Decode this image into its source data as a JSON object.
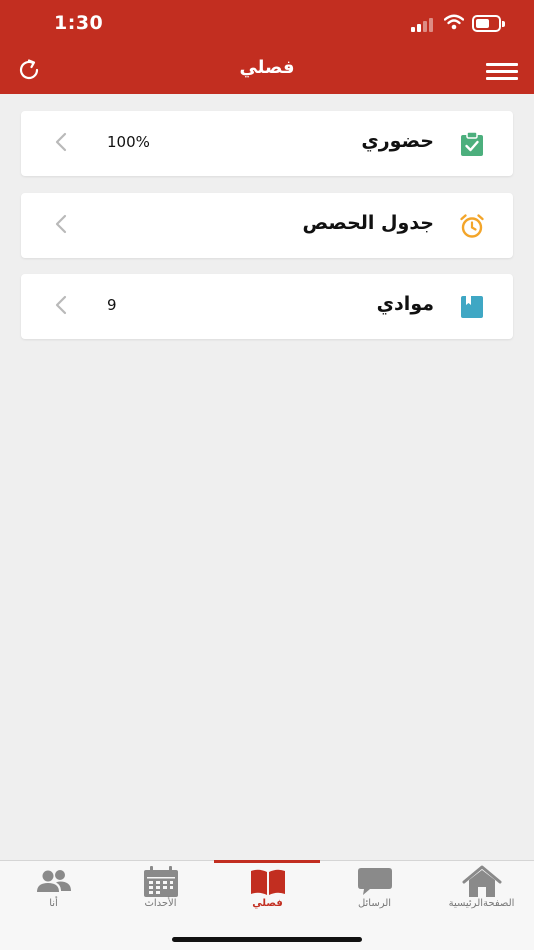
{
  "status": {
    "time": "1:30"
  },
  "header": {
    "title": "فصلي",
    "refresh_icon": "refresh-icon",
    "menu_icon": "hamburger-menu-icon"
  },
  "colors": {
    "brand": "#c22e20",
    "attendance": "#4caf7d",
    "schedule": "#f3a52a",
    "subjects": "#3fa7c4"
  },
  "cards": [
    {
      "label": "حضوري",
      "value": "100%",
      "icon": "clipboard-check-icon"
    },
    {
      "label": "جدول الحصص",
      "value": "",
      "icon": "alarm-clock-icon"
    },
    {
      "label": "موادي",
      "value": "9",
      "icon": "book-icon"
    }
  ],
  "tabs": [
    {
      "label": "أنا",
      "icon": "people-icon",
      "active": false
    },
    {
      "label": "الأحداث",
      "icon": "calendar-icon",
      "active": false
    },
    {
      "label": "فصلي",
      "icon": "open-book-icon",
      "active": true
    },
    {
      "label": "الرسائل",
      "icon": "chat-bubble-icon",
      "active": false
    },
    {
      "label": "الصفحةالرئيسية",
      "icon": "home-icon",
      "active": false
    }
  ]
}
